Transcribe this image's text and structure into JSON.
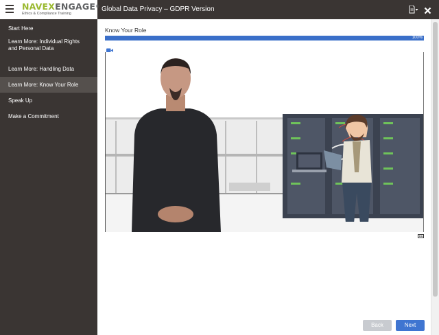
{
  "brand": {
    "navex": "NAVEX",
    "engage": "ENGAGE",
    "registered": "®",
    "tagline": "Ethics & Compliance Training"
  },
  "header": {
    "course_title": "Global Data Privacy – GDPR Version"
  },
  "sidebar": {
    "items": [
      {
        "label": "Start Here",
        "active": false
      },
      {
        "label": "Learn More: Individual Rights and Personal Data",
        "active": false
      },
      {
        "label": "Learn More: Handling Data",
        "active": false
      },
      {
        "label": "Learn More: Know Your Role",
        "active": true
      },
      {
        "label": "Speak Up",
        "active": false
      },
      {
        "label": "Make a Commitment",
        "active": false
      }
    ]
  },
  "main": {
    "section_title": "Know Your Role",
    "progress": {
      "value": 100,
      "label": "100%"
    },
    "video": {
      "captions_icon": "cc-icon",
      "media_icon": "camera-icon"
    },
    "cc_label": "CC"
  },
  "footer": {
    "back_label": "Back",
    "next_label": "Next"
  },
  "colors": {
    "sidebar_bg": "#3a3533",
    "active_item_bg": "#55504d",
    "accent": "#3f75d1",
    "brand_green": "#9ab92f"
  }
}
